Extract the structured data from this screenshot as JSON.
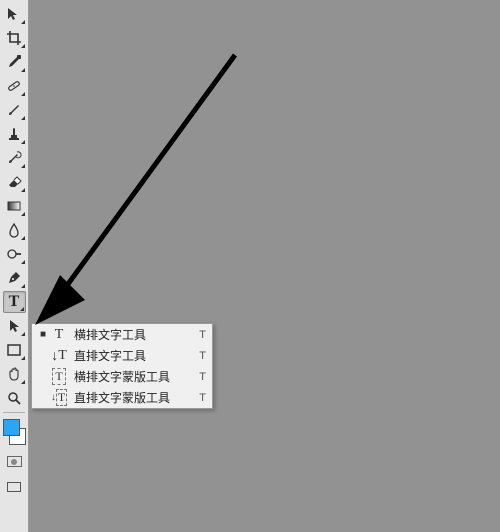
{
  "toolbar": {
    "tools": [
      {
        "name": "move-tool"
      },
      {
        "name": "crop-tool"
      },
      {
        "name": "eyedropper-tool"
      },
      {
        "name": "healing-brush-tool"
      },
      {
        "name": "brush-tool"
      },
      {
        "name": "clone-stamp-tool"
      },
      {
        "name": "history-brush-tool"
      },
      {
        "name": "eraser-tool"
      },
      {
        "name": "gradient-tool"
      },
      {
        "name": "blur-tool"
      },
      {
        "name": "dodge-tool"
      },
      {
        "name": "pen-tool"
      },
      {
        "name": "type-tool",
        "selected": true
      },
      {
        "name": "path-selection-tool"
      },
      {
        "name": "rectangle-shape-tool"
      },
      {
        "name": "hand-tool"
      },
      {
        "name": "zoom-tool"
      }
    ],
    "foreground_color": "#2aa6f7",
    "background_color": "#ffffff"
  },
  "type_flyout": {
    "items": [
      {
        "label": "横排文字工具",
        "shortcut": "T",
        "checked": true,
        "icon": "horizontal-type-icon"
      },
      {
        "label": "直排文字工具",
        "shortcut": "T",
        "checked": false,
        "icon": "vertical-type-icon"
      },
      {
        "label": "横排文字蒙版工具",
        "shortcut": "T",
        "checked": false,
        "icon": "horizontal-type-mask-icon"
      },
      {
        "label": "直排文字蒙版工具",
        "shortcut": "T",
        "checked": false,
        "icon": "vertical-type-mask-icon"
      }
    ]
  }
}
